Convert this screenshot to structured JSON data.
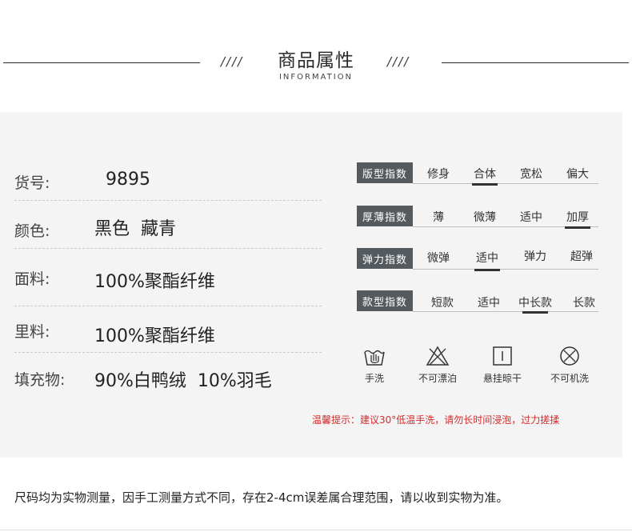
{
  "header": {
    "title": "商品属性",
    "subtitle": "INFORMATION",
    "slashes_left": "////",
    "slashes_right": "////"
  },
  "attributes": [
    {
      "label": "货号:",
      "value": "9895"
    },
    {
      "label": "颜色:",
      "value": "黑色  藏青"
    },
    {
      "label": "面料:",
      "value": "100%聚酯纤维"
    },
    {
      "label": "里料:",
      "value": "100%聚酯纤维"
    },
    {
      "label": "填充物:",
      "value": "90%白鸭绒  10%羽毛"
    }
  ],
  "indices": [
    {
      "name": "版型指数",
      "options": [
        "修身",
        "合体",
        "宽松",
        "偏大"
      ],
      "selected": 1
    },
    {
      "name": "厚薄指数",
      "options": [
        "薄",
        "微薄",
        "适中",
        "加厚"
      ],
      "selected": 3
    },
    {
      "name": "弹力指数",
      "options": [
        "微弹",
        "适中",
        "弹力",
        "超弹"
      ],
      "selected": 1
    },
    {
      "name": "款型指数",
      "options": [
        "短款",
        "适中",
        "中长款",
        "长款"
      ],
      "selected": 2
    }
  ],
  "care": [
    {
      "icon": "hand-wash-icon",
      "label": "手洗"
    },
    {
      "icon": "no-bleach-icon",
      "label": "不可漂泊"
    },
    {
      "icon": "hang-dry-icon",
      "label": "悬挂晾干"
    },
    {
      "icon": "no-machine-wash-icon",
      "label": "不可机洗"
    }
  ],
  "warm_tip": "温馨提示：建议30°低温手洗，请勿长时间浸泡，过力搓揉",
  "footer_note": "尺码均为实物测量，因手工测量方式不同，存在2-4cm误差属合理范围，请以收到实物为准。",
  "colors": {
    "badge": "#555a5e",
    "tip": "#d62b2b",
    "panel": "#f4f4f4"
  }
}
